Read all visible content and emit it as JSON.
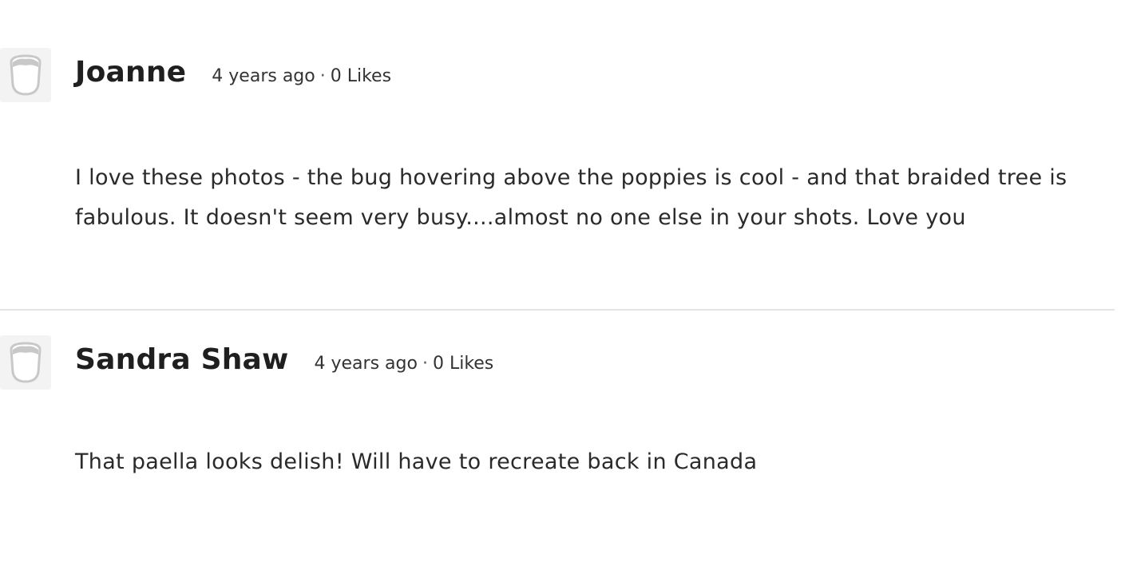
{
  "comments": [
    {
      "author": "Joanne",
      "time": "4 years ago",
      "separator": "·",
      "likes": "0 Likes",
      "text": "I love these photos - the bug hovering above the poppies is cool - and that braided tree is fabulous. It doesn't seem very busy....almost no one else in your shots. Love you",
      "avatar_icon": "user-placeholder-icon"
    },
    {
      "author": "Sandra Shaw",
      "time": "4 years ago",
      "separator": "·",
      "likes": "0 Likes",
      "text": "That paella looks delish! Will have to recreate back in Canada",
      "avatar_icon": "user-placeholder-icon"
    }
  ],
  "colors": {
    "text": "#222222",
    "avatar_bg": "#f3f3f3",
    "avatar_icon": "#c8c8c8",
    "divider": "#e4e4e4"
  }
}
